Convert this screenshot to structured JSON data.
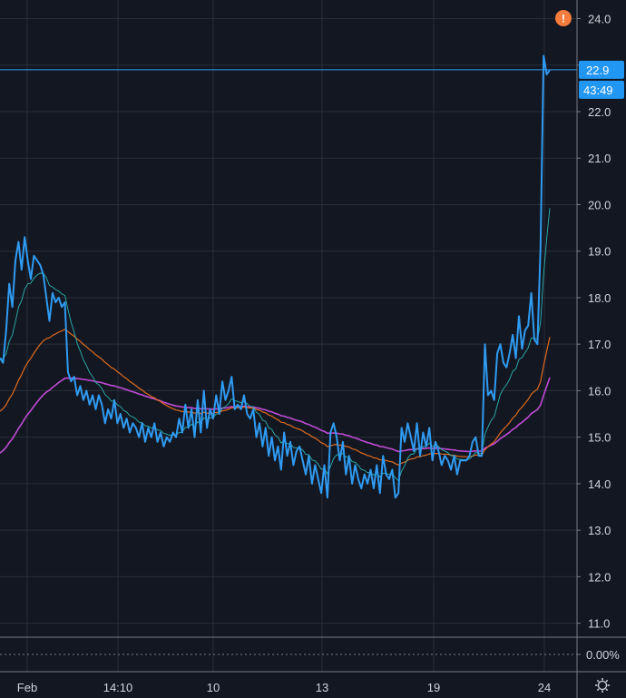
{
  "chart_data": {
    "type": "line",
    "x_tick_labels": [
      "Feb",
      "14:10",
      "10",
      "13",
      "19",
      "24"
    ],
    "y_ticks": [
      24.0,
      23.0,
      22.0,
      21.0,
      20.0,
      19.0,
      18.0,
      17.0,
      16.0,
      15.0,
      14.0,
      13.0,
      12.0,
      11.0
    ],
    "y_tick_labels": [
      "24.0",
      "23.0",
      "22.0",
      "21.0",
      "20.0",
      "19.0",
      "18.0",
      "17.0",
      "16.0",
      "15.0",
      "14.0",
      "13.0",
      "12.0",
      "11.0"
    ],
    "ylim": [
      10.7,
      24.4
    ],
    "grid": true,
    "last_price": 22.9,
    "last_price_label": "22.9",
    "countdown_label": "43:49",
    "alert_label": "!",
    "indicator_value_label": "0.00%",
    "series": [
      {
        "values": [
          16.7,
          16.6,
          17.3,
          18.3,
          17.8,
          18.8,
          19.2,
          18.6,
          19.3,
          18.8,
          18.4,
          18.9,
          18.8,
          18.7,
          18.5,
          18.0,
          17.5,
          18.1,
          17.9,
          18.0,
          17.8,
          17.9,
          16.4,
          16.2,
          16.3,
          15.9,
          16.1,
          15.8,
          16.0,
          15.7,
          15.9,
          15.6,
          15.9,
          15.7,
          15.3,
          15.6,
          15.4,
          15.8,
          15.3,
          15.5,
          15.2,
          15.4,
          15.1,
          15.3,
          15.2,
          15.0,
          15.3,
          14.9,
          15.2,
          15.0,
          15.3,
          14.9,
          15.1,
          14.8,
          15.0,
          14.9,
          15.1,
          15.0,
          15.4,
          15.1,
          15.7,
          15.2,
          15.6,
          15.0,
          15.8,
          15.1,
          16.0,
          15.2,
          15.6,
          15.4,
          15.9,
          15.5,
          16.2,
          15.8,
          16.0,
          16.3,
          15.6,
          15.7,
          15.6,
          15.9,
          15.5,
          15.4,
          15.6,
          15.0,
          15.3,
          14.8,
          15.2,
          14.6,
          15.0,
          14.5,
          14.8,
          14.3,
          15.1,
          14.6,
          14.9,
          14.4,
          14.7,
          14.8,
          14.5,
          14.2,
          14.6,
          14.0,
          14.4,
          14.1,
          13.8,
          14.4,
          13.7,
          15.1,
          15.3,
          15.0,
          14.5,
          14.9,
          14.2,
          14.6,
          14.0,
          14.4,
          14.1,
          13.9,
          14.2,
          14.0,
          14.3,
          13.9,
          14.4,
          13.8,
          14.6,
          14.2,
          14.1,
          14.3,
          13.7,
          13.8,
          15.2,
          14.9,
          15.3,
          15.0,
          14.7,
          15.3,
          14.6,
          15.1,
          14.8,
          15.2,
          14.5,
          14.9,
          14.7,
          14.4,
          14.6,
          14.5,
          14.3,
          14.6,
          14.2,
          14.5,
          14.5,
          14.5,
          14.6,
          14.9,
          15.0,
          14.6,
          14.6,
          17.0,
          15.9,
          16.0,
          15.8,
          16.8,
          17.0,
          16.6,
          16.5,
          16.8,
          17.2,
          16.7,
          17.6,
          16.9,
          17.3,
          17.4,
          18.1,
          17.1,
          17.0,
          19.1,
          23.2,
          22.8,
          22.9
        ]
      }
    ]
  }
}
